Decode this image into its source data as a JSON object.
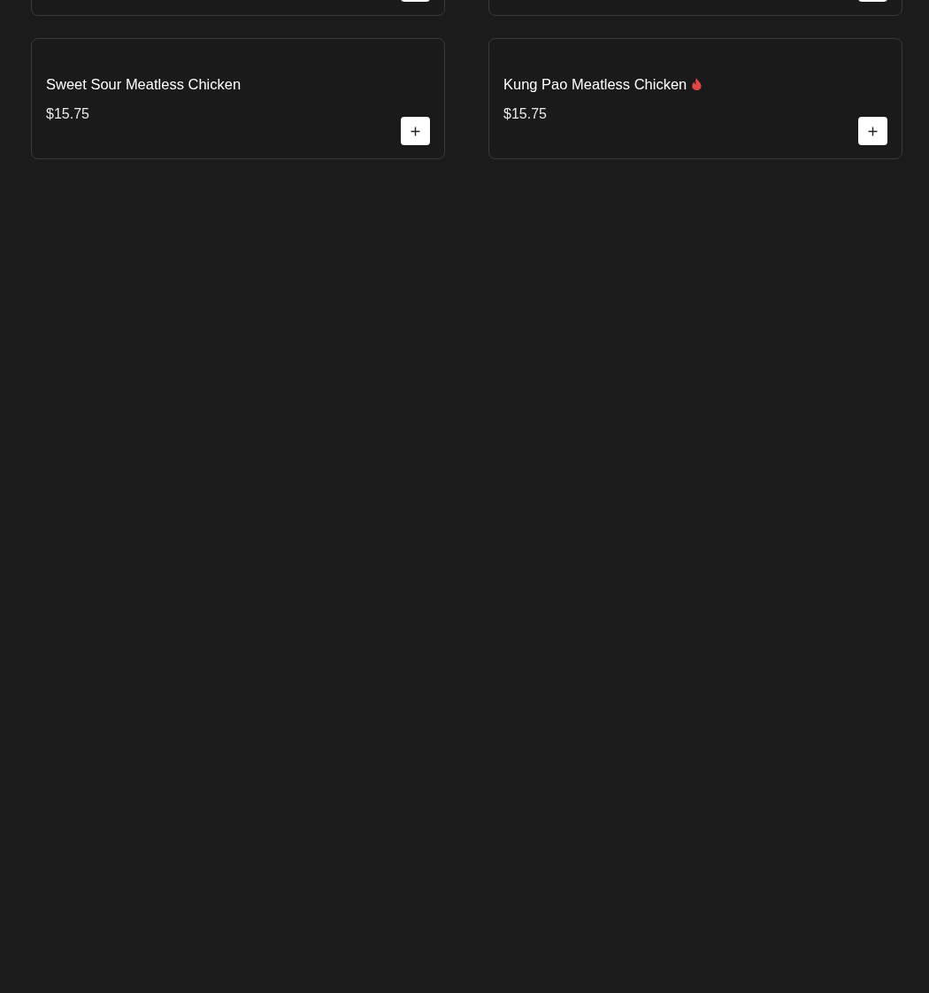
{
  "menu_items": [
    {
      "kind": "partial"
    },
    {
      "kind": "partial"
    },
    {
      "kind": "full",
      "name": "Sweet Sour Meatless Chicken",
      "price": "$15.75",
      "spicy": false
    },
    {
      "kind": "full",
      "name": "Kung Pao Meatless Chicken",
      "price": "$15.75",
      "spicy": true
    }
  ]
}
